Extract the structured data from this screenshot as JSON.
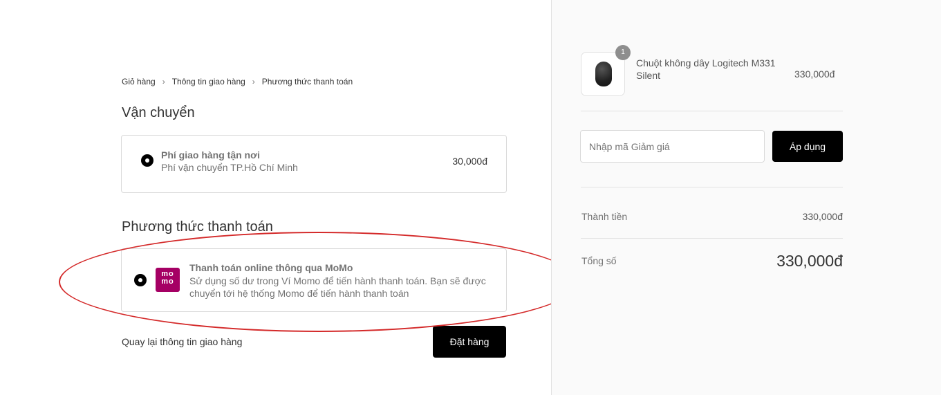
{
  "breadcrumb": {
    "items": [
      "Giỏ hàng",
      "Thông tin giao hàng",
      "Phương thức thanh toán"
    ],
    "separator": "›"
  },
  "shipping": {
    "title": "Vận chuyển",
    "option_name": "Phí giao hàng tận nơi",
    "option_desc": "Phí vận chuyển TP.Hồ Chí Minh",
    "option_price": "30,000đ"
  },
  "payment": {
    "title": "Phương thức thanh toán",
    "logo_text_top": "mo",
    "logo_text_bottom": "mo",
    "method_name": "Thanh toán online thông qua MoMo",
    "method_desc": "Sử dụng số dư trong Ví Momo để tiến hành thanh toán. Bạn sẽ được chuyển tới hệ thống Momo để tiến hành thanh toán",
    "brand_color": "#a50064"
  },
  "footer": {
    "back_label": "Quay lại thông tin giao hàng",
    "order_label": "Đặt hàng"
  },
  "cart": {
    "item_qty": "1",
    "item_name": "Chuột không dây Logitech M331 Silent",
    "item_price": "330,000đ"
  },
  "coupon": {
    "placeholder": "Nhập mã Giảm giá",
    "apply_label": "Áp dụng"
  },
  "summary": {
    "subtotal_label": "Thành tiền",
    "subtotal_value": "330,000đ",
    "total_label": "Tổng số",
    "total_value": "330,000đ"
  },
  "annotation": {
    "color": "#d42a2a"
  }
}
